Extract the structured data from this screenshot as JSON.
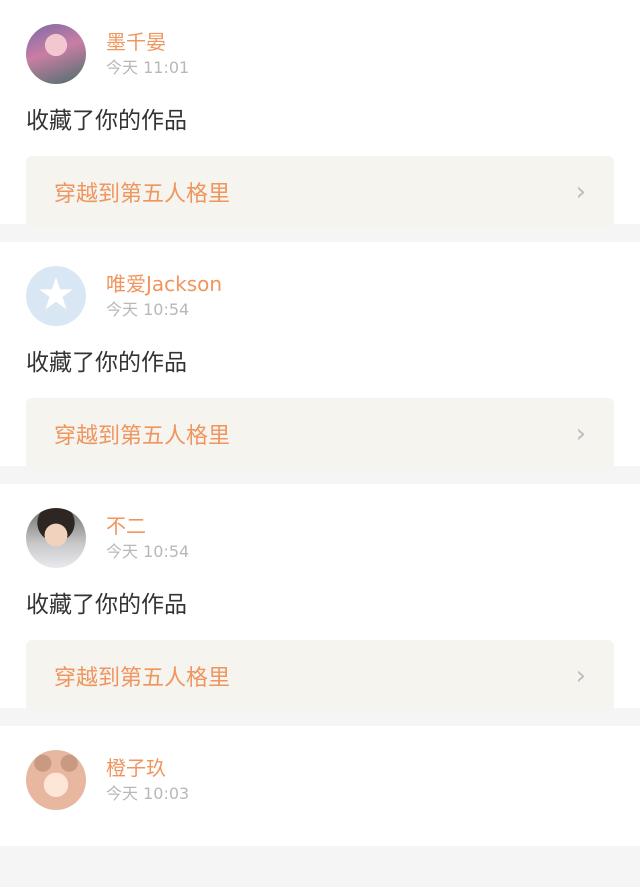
{
  "feed": {
    "items": [
      {
        "username": "墨千晏",
        "time": "今天 11:01",
        "action": "收藏了你的作品",
        "work_title": "穿越到第五人格里",
        "avatar_icon": "user-avatar-anime-girl"
      },
      {
        "username": "唯爱Jackson",
        "time": "今天 10:54",
        "action": "收藏了你的作品",
        "work_title": "穿越到第五人格里",
        "avatar_icon": "default-avatar-star-icon"
      },
      {
        "username": "不二",
        "time": "今天 10:54",
        "action": "收藏了你的作品",
        "work_title": "穿越到第五人格里",
        "avatar_icon": "user-avatar-boy-portrait"
      },
      {
        "username": "橙子玖",
        "time": "今天 10:03",
        "avatar_icon": "user-avatar-bear-girl"
      }
    ],
    "chevron_icon": "chevron-right-icon"
  },
  "colors": {
    "accent": "#f0955e",
    "time_gray": "#b8b8b8",
    "card_bg": "#f5f4ef",
    "page_bg": "#f5f5f5"
  }
}
